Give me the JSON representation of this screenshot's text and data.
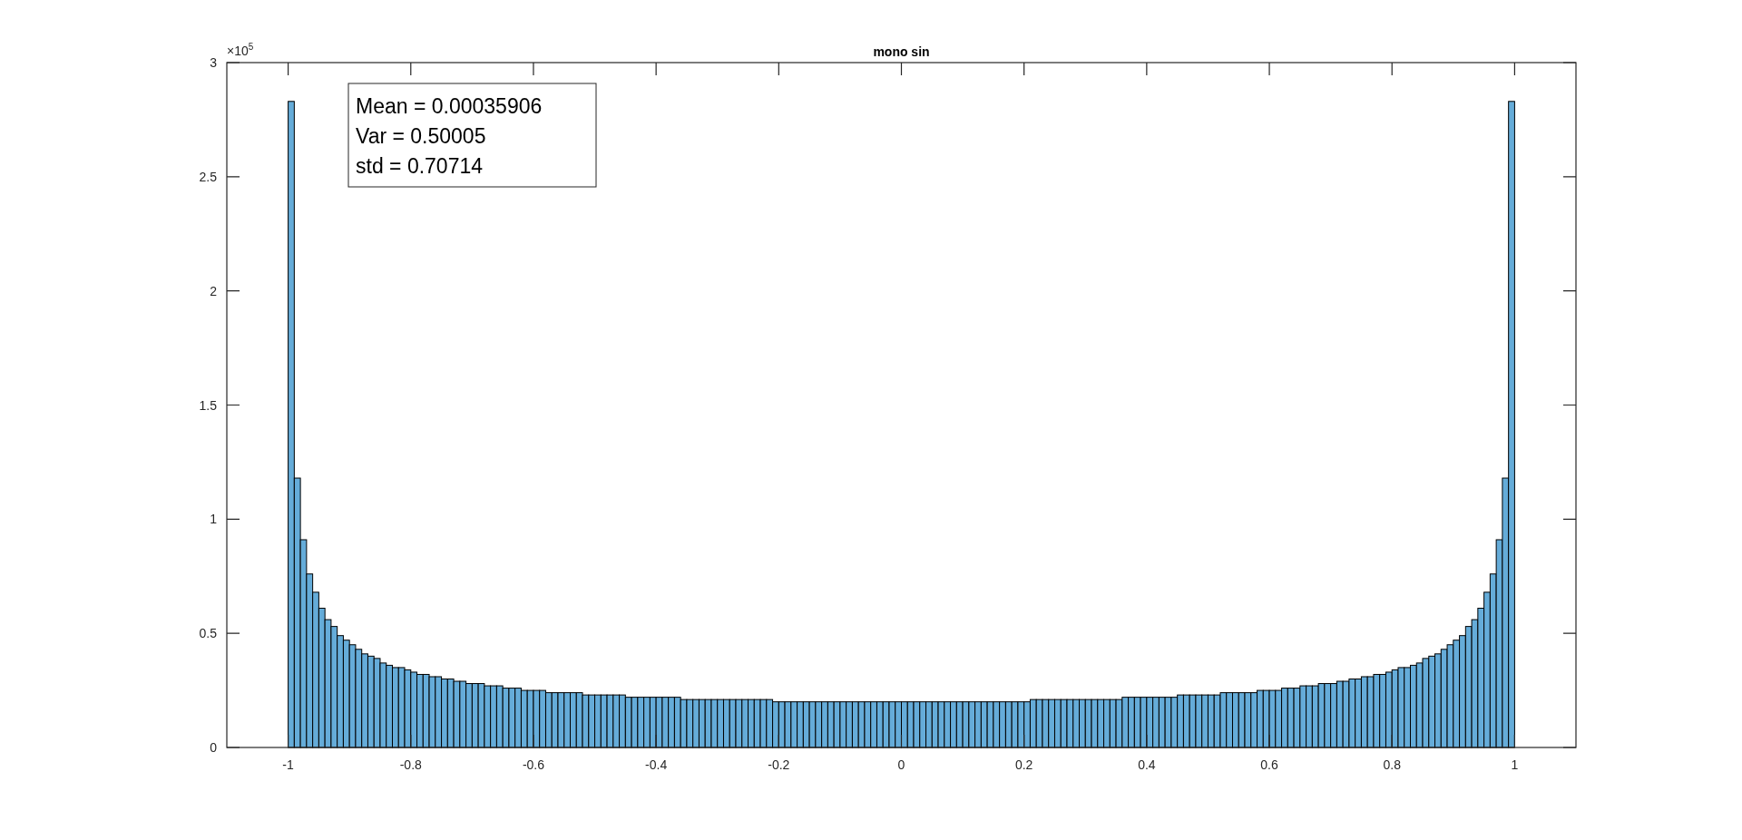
{
  "figure": {
    "chart_data": {
      "type": "bar",
      "title": "mono sin",
      "x": [
        -0.995,
        -0.985,
        -0.975,
        -0.965,
        -0.955,
        -0.945,
        -0.935,
        -0.925,
        -0.915,
        -0.905,
        -0.895,
        -0.885,
        -0.875,
        -0.865,
        -0.855,
        -0.845,
        -0.835,
        -0.825,
        -0.815,
        -0.805,
        -0.795,
        -0.785,
        -0.775,
        -0.765,
        -0.755,
        -0.745,
        -0.735,
        -0.725,
        -0.715,
        -0.705,
        -0.695,
        -0.685,
        -0.675,
        -0.665,
        -0.655,
        -0.645,
        -0.635,
        -0.625,
        -0.615,
        -0.605,
        -0.595,
        -0.585,
        -0.575,
        -0.565,
        -0.555,
        -0.545,
        -0.535,
        -0.525,
        -0.515,
        -0.505,
        -0.495,
        -0.485,
        -0.475,
        -0.465,
        -0.455,
        -0.445,
        -0.435,
        -0.425,
        -0.415,
        -0.405,
        -0.395,
        -0.385,
        -0.375,
        -0.365,
        -0.355,
        -0.345,
        -0.335,
        -0.325,
        -0.315,
        -0.305,
        -0.295,
        -0.285,
        -0.275,
        -0.265,
        -0.255,
        -0.245,
        -0.235,
        -0.225,
        -0.215,
        -0.205,
        -0.195,
        -0.185,
        -0.175,
        -0.165,
        -0.155,
        -0.145,
        -0.135,
        -0.125,
        -0.115,
        -0.105,
        -0.095,
        -0.085,
        -0.075,
        -0.065,
        -0.055,
        -0.045,
        -0.035,
        -0.025,
        -0.015,
        -0.005,
        0.005,
        0.015,
        0.025,
        0.035,
        0.045,
        0.055,
        0.065,
        0.075,
        0.085,
        0.095,
        0.105,
        0.115,
        0.125,
        0.135,
        0.145,
        0.155,
        0.165,
        0.175,
        0.185,
        0.195,
        0.205,
        0.215,
        0.225,
        0.235,
        0.245,
        0.255,
        0.265,
        0.275,
        0.285,
        0.295,
        0.305,
        0.315,
        0.325,
        0.335,
        0.345,
        0.355,
        0.365,
        0.375,
        0.385,
        0.395,
        0.405,
        0.415,
        0.425,
        0.435,
        0.445,
        0.455,
        0.465,
        0.475,
        0.485,
        0.495,
        0.505,
        0.515,
        0.525,
        0.535,
        0.545,
        0.555,
        0.565,
        0.575,
        0.585,
        0.595,
        0.605,
        0.615,
        0.625,
        0.635,
        0.645,
        0.655,
        0.665,
        0.675,
        0.685,
        0.695,
        0.705,
        0.715,
        0.725,
        0.735,
        0.745,
        0.755,
        0.765,
        0.775,
        0.785,
        0.795,
        0.805,
        0.815,
        0.825,
        0.835,
        0.845,
        0.855,
        0.865,
        0.875,
        0.885,
        0.895,
        0.905,
        0.915,
        0.925,
        0.935,
        0.945,
        0.955,
        0.965,
        0.975,
        0.985,
        0.995
      ],
      "series": [
        {
          "color": "#65acd9",
          "values": [
            2.83,
            1.18,
            0.91,
            0.76,
            0.68,
            0.61,
            0.56,
            0.53,
            0.49,
            0.47,
            0.45,
            0.43,
            0.41,
            0.4,
            0.39,
            0.37,
            0.36,
            0.35,
            0.35,
            0.34,
            0.33,
            0.32,
            0.32,
            0.31,
            0.31,
            0.3,
            0.3,
            0.29,
            0.29,
            0.28,
            0.28,
            0.28,
            0.27,
            0.27,
            0.27,
            0.26,
            0.26,
            0.26,
            0.25,
            0.25,
            0.25,
            0.25,
            0.24,
            0.24,
            0.24,
            0.24,
            0.24,
            0.24,
            0.23,
            0.23,
            0.23,
            0.23,
            0.23,
            0.23,
            0.23,
            0.22,
            0.22,
            0.22,
            0.22,
            0.22,
            0.22,
            0.22,
            0.22,
            0.22,
            0.21,
            0.21,
            0.21,
            0.21,
            0.21,
            0.21,
            0.21,
            0.21,
            0.21,
            0.21,
            0.21,
            0.21,
            0.21,
            0.21,
            0.21,
            0.2,
            0.2,
            0.2,
            0.2,
            0.2,
            0.2,
            0.2,
            0.2,
            0.2,
            0.2,
            0.2,
            0.2,
            0.2,
            0.2,
            0.2,
            0.2,
            0.2,
            0.2,
            0.2,
            0.2,
            0.2,
            0.2,
            0.2,
            0.2,
            0.2,
            0.2,
            0.2,
            0.2,
            0.2,
            0.2,
            0.2,
            0.2,
            0.2,
            0.2,
            0.2,
            0.2,
            0.2,
            0.2,
            0.2,
            0.2,
            0.2,
            0.2,
            0.21,
            0.21,
            0.21,
            0.21,
            0.21,
            0.21,
            0.21,
            0.21,
            0.21,
            0.21,
            0.21,
            0.21,
            0.21,
            0.21,
            0.21,
            0.22,
            0.22,
            0.22,
            0.22,
            0.22,
            0.22,
            0.22,
            0.22,
            0.22,
            0.23,
            0.23,
            0.23,
            0.23,
            0.23,
            0.23,
            0.23,
            0.24,
            0.24,
            0.24,
            0.24,
            0.24,
            0.24,
            0.25,
            0.25,
            0.25,
            0.25,
            0.26,
            0.26,
            0.26,
            0.27,
            0.27,
            0.27,
            0.28,
            0.28,
            0.28,
            0.29,
            0.29,
            0.3,
            0.3,
            0.31,
            0.31,
            0.32,
            0.32,
            0.33,
            0.34,
            0.35,
            0.35,
            0.36,
            0.37,
            0.39,
            0.4,
            0.41,
            0.43,
            0.45,
            0.47,
            0.49,
            0.53,
            0.56,
            0.61,
            0.68,
            0.76,
            0.91,
            1.18,
            2.83
          ]
        }
      ],
      "xlim": [
        -1.1,
        1.1
      ],
      "ylim": [
        0,
        3
      ],
      "xticks": [
        {
          "value": -1,
          "label": "-1"
        },
        {
          "value": -0.8,
          "label": "-0.8"
        },
        {
          "value": -0.6,
          "label": "-0.6"
        },
        {
          "value": -0.4,
          "label": "-0.4"
        },
        {
          "value": -0.2,
          "label": "-0.2"
        },
        {
          "value": 0,
          "label": "0"
        },
        {
          "value": 0.2,
          "label": "0.2"
        },
        {
          "value": 0.4,
          "label": "0.4"
        },
        {
          "value": 0.6,
          "label": "0.6"
        },
        {
          "value": 0.8,
          "label": "0.8"
        },
        {
          "value": 1,
          "label": "1"
        }
      ],
      "yticks": [
        0,
        0.5,
        1,
        1.5,
        2,
        2.5,
        3
      ],
      "annotations": [
        "Mean = 0.00035906",
        "Var = 0.50005",
        "std = 0.70714"
      ]
    },
    "y_axis_multiplier": {
      "base": "×10",
      "power": "5"
    }
  }
}
